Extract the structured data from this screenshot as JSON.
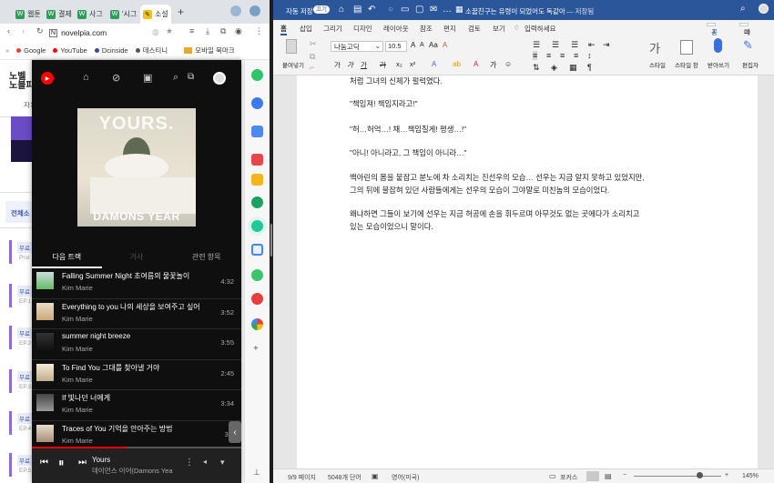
{
  "browser": {
    "tabs": [
      "웹툰",
      "결제",
      "사그",
      "'시그",
      "소설"
    ],
    "url": "novelpia.com",
    "bookmarks": [
      "Google",
      "YouTube",
      "Dcinside",
      "데스티니"
    ],
    "bookmarks_folder": "모바일 북마크"
  },
  "novelpia": {
    "logo_line1": "노벨",
    "logo_line2": "노블피",
    "nav_label": "자유",
    "all_label": "전체소",
    "badge": "무료",
    "side_texts": [
      "Prol",
      "EP.1",
      "EP.2",
      "EP.3",
      "EP.4",
      "EP.5"
    ]
  },
  "ytmusic": {
    "album_art_title": "YOURS.",
    "album_art_subtitle": "DAMONS YEAR",
    "tabs": [
      "다음 트랙",
      "가사",
      "관련 항목"
    ],
    "tracks": [
      {
        "title": "Falling Summer Night 초여름의 물꽃놀이",
        "artist": "Kim Marie",
        "duration": "4:32"
      },
      {
        "title": "Everything to you 나의 세상을 보여주고 싶어",
        "artist": "Kim Marie",
        "duration": "3:52"
      },
      {
        "title": "summer night breeze",
        "artist": "Kim Marie",
        "duration": "3:55"
      },
      {
        "title": "To Find You 그대를 찾아낼 거야",
        "artist": "Kim Marie",
        "duration": "2:45"
      },
      {
        "title": "If 빛나던 너에게",
        "artist": "Kim Marie",
        "duration": "3:34"
      },
      {
        "title": "Traces of You 기억을 안아주는 방법",
        "artist": "Kim Marie",
        "duration": "3:1"
      }
    ],
    "now_playing": {
      "title": "Yours",
      "artist": "데이먼스 이어(Damons Yea",
      "progress": 0.45
    }
  },
  "word": {
    "autosave": "자동 저장",
    "toggle": "끄기",
    "doc_title": "소꿉친구는 유령이 되었어도 독같아",
    "doc_suffix": "— 저장됨",
    "menu": [
      "홈",
      "삽입",
      "그리기",
      "디자인",
      "레이아웃",
      "참조",
      "편지",
      "검토",
      "보기",
      "입력하세요"
    ],
    "share": "공유",
    "comment": "메모",
    "ribbon": {
      "paste": "붙여넣기",
      "font": "나눔고딕",
      "size": "10.5",
      "styles": "스타일",
      "style_pane": "스타일 창",
      "dictate": "받아쓰기",
      "editor": "편집자"
    },
    "paragraphs": [
      "처럼 그녀의 신체가 펄럭였다.",
      "\"책임져! 책임지라고!\"",
      "\"허…허억…! 채…책임질게! 평생…!\"",
      "\"아니! 아니라고, 그 책임이 아니라…\"",
      "백아린의 몸을 붙잡고 분노에 차 소리치는 진선우의 모습… 선우는 지금 알지 못하고 있었지만,",
      "그의 뒤에 불잡혀 있던 사람들에게는 선우의 모습이 그야말로 미친놈의 모습이었다.",
      "왜냐하면 그들이 보기에 선우는 지금 허공에 손을 휘두르며 아무것도 없는 곳에다가 소리치고",
      "있는 모습이었으니 말이다."
    ],
    "status": {
      "page": "9/9 페이지",
      "words": "5048개 단어",
      "lang": "영어(미국)",
      "focus": "포커스",
      "zoom": "145%"
    }
  },
  "colors": {
    "word_blue": "#2b579a",
    "yt_red": "#ff0000"
  }
}
